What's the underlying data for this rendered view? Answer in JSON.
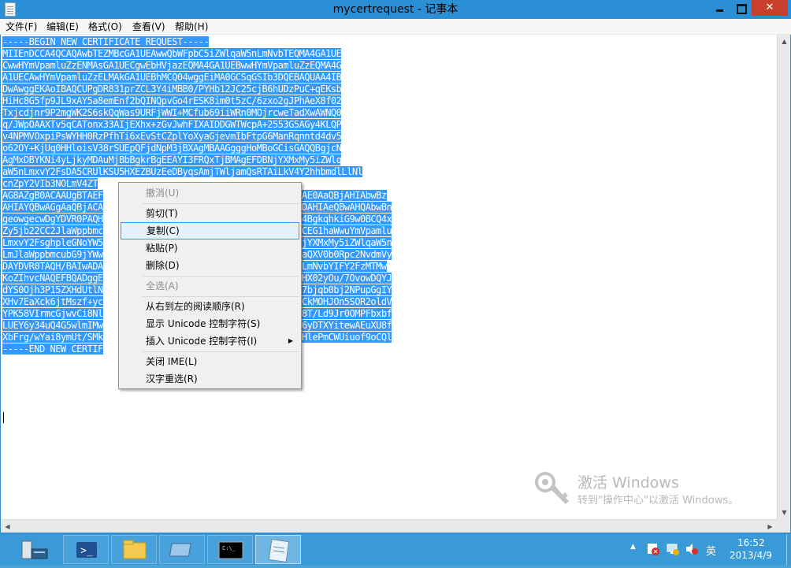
{
  "window": {
    "title": "mycertrequest - 记事本"
  },
  "menu": {
    "file": "文件(F)",
    "edit": "编辑(E)",
    "format": "格式(O)",
    "view": "查看(V)",
    "help": "帮助(H)"
  },
  "editor": {
    "lines": [
      "-----BEGIN NEW CERTIFICATE REQUEST-----",
      "MIIEnDCCA4QCAQAwbTEZMBcGA1UEAwwQbWFpbC5iZWlqaW5nLmNvbTEQMA4GA1UE",
      "CwwHYmVpamluZzENMAsGA1UECgwEbHVjazEQMA4GA1UEBwwHYmVpamluZzEQMA4G",
      "A1UECAwHYmVpamluZzELMAkGA1UEBhMCQ04wggEiMA0GCSqGSIb3DQEBAQUAA4IB",
      "DwAwggEKAoIBAQCUPgDR831prZCL3Y4iMBB0/PYHb12JC25cjB6hUDzPuC+qEKsb",
      "HiHc8G5fp9JL9xAY5a8emEnf2bQINQpvGo4rESK8im0t5zC/6zxo2gJPhAeX8f02",
      "Txjcdjnr9P2mgWK2S6skQqWas9URFjWWI+MCfub69iiWRn0MOjrcweTadXwAWNQ0",
      "q/JWpOAAXTv5qCATonx33AIjEXhx+zGvJwhFIXAIDDGWTWcpA+2553G5AGy4KLQP",
      "v4NPMVOxpiPsWYHH0RzPfhTi6xEvStCZplYoXyaGjevmIbFtpG6ManRqnntd4dv5",
      "o62OY+KjUq0HHloisV38rSUEpQFjdNpM3jBXAgMBAAGgggHoMBoGCisGAQQBgjcN",
      "AgMxDBYKNi4yLjkyMDAuMjBbBgkrBgEEAYI3FRQxTjBMAgEFDBNjYXMxMy5iZWlq",
      "aW5nLmxvY2FsDA5CRUlKSU5HXEZBUzEeDByqsAmjTWljamQsRTAiLkV4Y2hhbmdlLlNl",
      "cnZpY2VIb3NOLmV4ZT",
      "AG8AZgB0ACAAUgBTAEF",
      "AHIAYQBwAGgAaQBjACA",
      "geowgecwDgYDVR0PAQH",
      "Zy5jb22CC2JlaWppbmc",
      "LmxvY2FsghpleGNoYW5",
      "LmJlaWppbmcubG9jYWw",
      "DAYDVR0TAQH/BAIwADA",
      "KoZIhvcNAQEFBQADggE",
      "dYS0Ojh3P15ZXHdUtlN",
      "XHv7EaXck6jtMszf+yc",
      "YPK58VIrmcGjwvCi8Nl",
      "LUEY6y34uQ4G5wlmIMw",
      "XbFrg/wYai8ymUt/SMk",
      "-----END NEW CERTIF"
    ]
  },
  "context_menu": {
    "items": [
      {
        "label": "撤消(U)",
        "enabled": false
      },
      {
        "label": "剪切(T)",
        "enabled": true
      },
      {
        "label": "复制(C)",
        "enabled": true
      },
      {
        "label": "粘贴(P)",
        "enabled": true
      },
      {
        "label": "删除(D)",
        "enabled": true
      },
      {
        "label": "全选(A)",
        "enabled": false
      },
      {
        "label": "从右到左的阅读顺序(R)",
        "enabled": true
      },
      {
        "label": "显示 Unicode 控制字符(S)",
        "enabled": true
      },
      {
        "label": "插入 Unicode 控制字符(I)",
        "enabled": true
      },
      {
        "label": "关闭 IME(L)",
        "enabled": true
      },
      {
        "label": "汉字重选(R)",
        "enabled": true
      }
    ],
    "right_fragments": [
      "AE0AaQBjAHIAbwBz",
      "DAHIAeQBwAHQAbwBn",
      "4BgkqhkiG9w0BCQ4x",
      "CEG1haWwuYmVpamlu",
      "jYXMxMy5iZWlqaW5n",
      "aQXV0b0Rpc2NvdmVy",
      "LmNvbYIFY2FzMTMw",
      "HX02yOu/7OvowDQYJ",
      "7bjqb0bj2NPupGgIY",
      "CkMOHJOn5SOR2oldV",
      "8T/Ld9Jr0OMPFbxbf",
      "6yDTXYitewAEuXU8f",
      "HlePmCWUiuof9oCQl"
    ]
  },
  "watermark": {
    "title": "激活 Windows",
    "subtitle": "转到\"操作中心\"以激活 Windows。"
  },
  "taskbar": {
    "time": "16:52",
    "date": "2013/4/9",
    "ime": "英"
  },
  "colors": {
    "selection": "#3399ff",
    "titlebar": "#2b8fd6",
    "taskbar": "#3a9ad8",
    "close": "#c7402c"
  }
}
